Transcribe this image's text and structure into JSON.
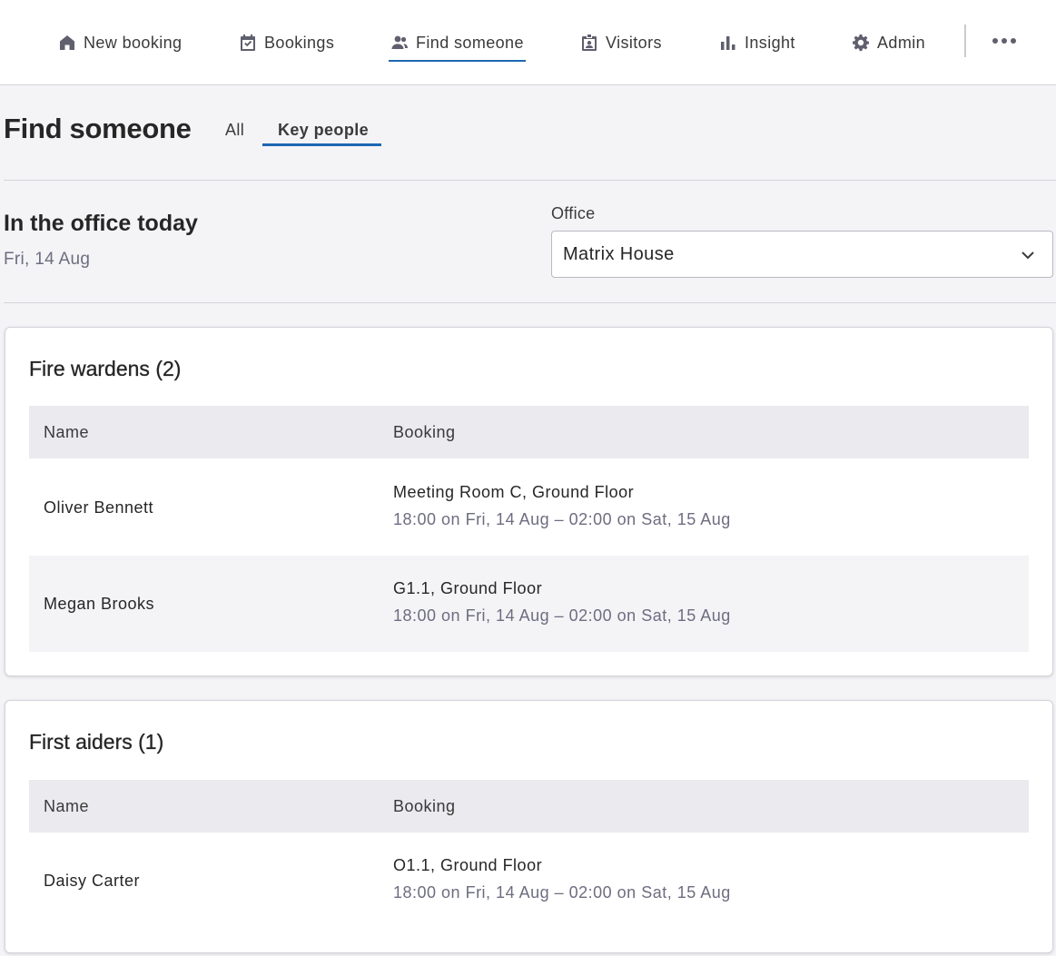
{
  "nav": {
    "items": [
      {
        "label": "New booking",
        "icon": "home-icon"
      },
      {
        "label": "Bookings",
        "icon": "calendar-check-icon"
      },
      {
        "label": "Find someone",
        "icon": "people-icon",
        "active": true
      },
      {
        "label": "Visitors",
        "icon": "visitor-badge-icon"
      },
      {
        "label": "Insight",
        "icon": "bar-chart-icon"
      },
      {
        "label": "Admin",
        "icon": "gear-icon"
      }
    ],
    "more_icon": "more-horizontal-icon"
  },
  "page": {
    "title": "Find someone",
    "tabs": [
      {
        "label": "All",
        "active": false
      },
      {
        "label": "Key people",
        "active": true
      }
    ]
  },
  "office_section": {
    "heading": "In the office today",
    "date": "Fri, 14 Aug",
    "office_label": "Office",
    "office_value": "Matrix House"
  },
  "groups": [
    {
      "title": "Fire wardens (2)",
      "columns": [
        "Name",
        "Booking"
      ],
      "rows": [
        {
          "name": "Oliver Bennett",
          "location": "Meeting Room C, Ground Floor",
          "time": "18:00 on Fri, 14 Aug – 02:00 on Sat, 15 Aug"
        },
        {
          "name": "Megan Brooks",
          "location": "G1.1, Ground Floor",
          "time": "18:00 on Fri, 14 Aug – 02:00 on Sat, 15 Aug"
        }
      ]
    },
    {
      "title": "First aiders (1)",
      "columns": [
        "Name",
        "Booking"
      ],
      "rows": [
        {
          "name": "Daisy Carter",
          "location": "O1.1, Ground Floor",
          "time": "18:00 on Fri, 14 Aug – 02:00 on Sat, 15 Aug"
        }
      ]
    }
  ],
  "colors": {
    "accent": "#1e67b4",
    "muted_text": "#6d6d80",
    "table_header_bg": "#eaeaef",
    "page_bg": "#f4f4f7"
  }
}
